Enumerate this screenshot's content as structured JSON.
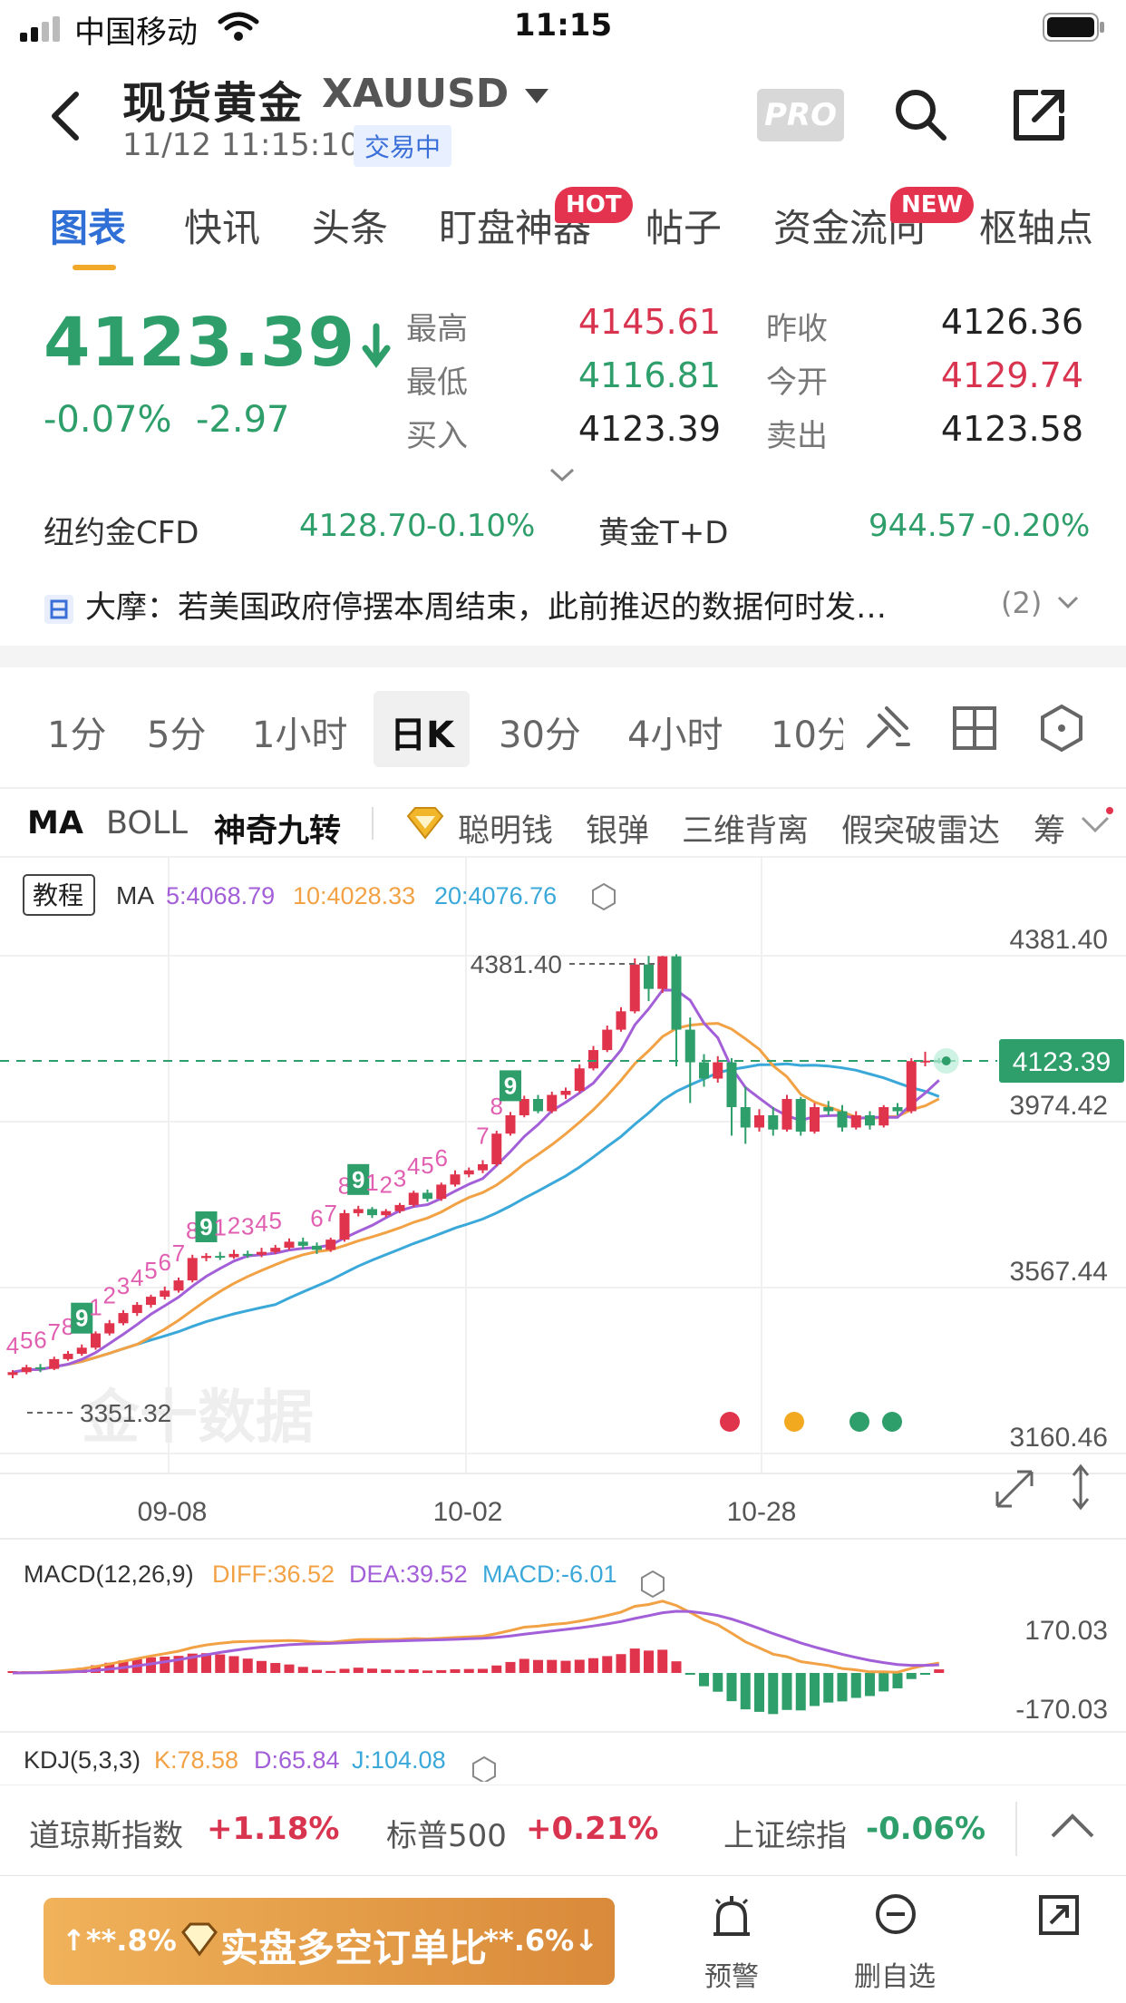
{
  "status_bar": {
    "carrier": "中国移动",
    "time": "11:15"
  },
  "header": {
    "title": "现货黄金",
    "symbol": "XAUUSD",
    "datetime": "11/12 11:15:10",
    "trading_status": "交易中",
    "pro_label": "PRO"
  },
  "tabs": [
    {
      "label": "图表",
      "active": true
    },
    {
      "label": "快讯"
    },
    {
      "label": "头条"
    },
    {
      "label": "盯盘神器",
      "badge": "HOT"
    },
    {
      "label": "帖子"
    },
    {
      "label": "资金流向",
      "badge": "NEW"
    },
    {
      "label": "枢轴点"
    }
  ],
  "quote": {
    "price": "4123.39",
    "change_pct": "-0.07%",
    "change": "-2.97",
    "high_label": "最高",
    "high": "4145.61",
    "low_label": "最低",
    "low": "4116.81",
    "bid_label": "买入",
    "bid": "4123.39",
    "prev_close_label": "昨收",
    "prev_close": "4126.36",
    "open_label": "今开",
    "open": "4129.74",
    "ask_label": "卖出",
    "ask": "4123.58"
  },
  "related": [
    {
      "name": "纽约金CFD",
      "price": "4128.70",
      "chg": "-0.10%"
    },
    {
      "name": "黄金T+D",
      "price": "944.57",
      "chg": "-0.20%"
    }
  ],
  "news": {
    "text": "大摩：若美国政府停摆本周结束，此前推迟的数据何时发…",
    "count": "(2)"
  },
  "periods": [
    {
      "label": "1分"
    },
    {
      "label": "5分"
    },
    {
      "label": "1小时"
    },
    {
      "label": "日K",
      "active": true
    },
    {
      "label": "30分"
    },
    {
      "label": "4小时"
    },
    {
      "label": "10分"
    }
  ],
  "indicators": [
    {
      "label": "MA",
      "bold": true
    },
    {
      "label": "BOLL"
    },
    {
      "label": "神奇九转",
      "bold": true
    },
    {
      "label": "聪明钱"
    },
    {
      "label": "银弹"
    },
    {
      "label": "三维背离"
    },
    {
      "label": "假突破雷达"
    },
    {
      "label": "筹"
    }
  ],
  "chart_data": {
    "type": "candlestick",
    "tutorial_label": "教程",
    "ma_legend": {
      "title": "MA",
      "ma5": "5:4068.79",
      "ma10": "10:4028.33",
      "ma20": "20:4076.76"
    },
    "y_ticks": [
      "4381.40",
      "3974.42",
      "3567.44",
      "3160.46"
    ],
    "ylim": [
      3160.46,
      4381.4
    ],
    "x_ticks": [
      "09-08",
      "10-02",
      "10-28"
    ],
    "current_price": "4123.39",
    "high_marker": "4381.40",
    "low_marker": "3351.32",
    "watermark": "金十数据",
    "candles": [
      [
        3353,
        3360,
        3345,
        3365
      ],
      [
        3360,
        3372,
        3355,
        3378
      ],
      [
        3372,
        3368,
        3360,
        3380
      ],
      [
        3368,
        3392,
        3365,
        3398
      ],
      [
        3392,
        3405,
        3388,
        3412
      ],
      [
        3405,
        3420,
        3400,
        3428
      ],
      [
        3420,
        3455,
        3415,
        3460
      ],
      [
        3455,
        3480,
        3450,
        3488
      ],
      [
        3480,
        3505,
        3475,
        3512
      ],
      [
        3505,
        3525,
        3498,
        3532
      ],
      [
        3525,
        3545,
        3518,
        3550
      ],
      [
        3545,
        3560,
        3538,
        3570
      ],
      [
        3560,
        3585,
        3555,
        3592
      ],
      [
        3585,
        3640,
        3580,
        3648
      ],
      [
        3640,
        3645,
        3632,
        3652
      ],
      [
        3645,
        3642,
        3635,
        3655
      ],
      [
        3642,
        3650,
        3638,
        3660
      ],
      [
        3650,
        3648,
        3640,
        3658
      ],
      [
        3648,
        3655,
        3642,
        3665
      ],
      [
        3655,
        3665,
        3650,
        3672
      ],
      [
        3665,
        3680,
        3660,
        3688
      ],
      [
        3680,
        3670,
        3662,
        3690
      ],
      [
        3670,
        3660,
        3650,
        3678
      ],
      [
        3660,
        3685,
        3655,
        3690
      ],
      [
        3685,
        3750,
        3680,
        3758
      ],
      [
        3750,
        3760,
        3742,
        3768
      ],
      [
        3760,
        3745,
        3738,
        3765
      ],
      [
        3745,
        3755,
        3740,
        3760
      ],
      [
        3755,
        3770,
        3750,
        3775
      ],
      [
        3770,
        3800,
        3765,
        3805
      ],
      [
        3800,
        3785,
        3778,
        3808
      ],
      [
        3785,
        3820,
        3780,
        3825
      ],
      [
        3820,
        3845,
        3815,
        3855
      ],
      [
        3845,
        3855,
        3838,
        3862
      ],
      [
        3855,
        3870,
        3848,
        3880
      ],
      [
        3870,
        3945,
        3865,
        3952
      ],
      [
        3945,
        3990,
        3940,
        3998
      ],
      [
        3990,
        4030,
        3985,
        4038
      ],
      [
        4030,
        4000,
        3995,
        4040
      ],
      [
        4000,
        4040,
        3995,
        4048
      ],
      [
        4040,
        4050,
        4030,
        4058
      ],
      [
        4050,
        4105,
        4045,
        4115
      ],
      [
        4105,
        4150,
        4100,
        4160
      ],
      [
        4150,
        4200,
        4145,
        4210
      ],
      [
        4200,
        4245,
        4195,
        4255
      ],
      [
        4245,
        4360,
        4240,
        4375
      ],
      [
        4360,
        4300,
        4270,
        4381
      ],
      [
        4300,
        4380,
        4290,
        4381
      ],
      [
        4380,
        4200,
        4110,
        4385
      ],
      [
        4200,
        4120,
        4020,
        4230
      ],
      [
        4120,
        4080,
        4060,
        4140
      ],
      [
        4080,
        4120,
        4070,
        4135
      ],
      [
        4120,
        4010,
        3940,
        4130
      ],
      [
        4010,
        3960,
        3920,
        4060
      ],
      [
        3960,
        3990,
        3950,
        4005
      ],
      [
        3990,
        3955,
        3940,
        4010
      ],
      [
        3955,
        4030,
        3950,
        4040
      ],
      [
        4030,
        3950,
        3940,
        4035
      ],
      [
        3950,
        4010,
        3945,
        4020
      ],
      [
        4010,
        4000,
        3990,
        4025
      ],
      [
        4000,
        3960,
        3950,
        4015
      ],
      [
        3960,
        3990,
        3955,
        4000
      ],
      [
        3990,
        3965,
        3955,
        4000
      ],
      [
        3965,
        4010,
        3960,
        4015
      ],
      [
        4010,
        4000,
        3990,
        4020
      ],
      [
        4000,
        4123,
        3995,
        4130
      ],
      [
        4123,
        4124,
        4110,
        4146
      ],
      [
        4124,
        4123,
        4117,
        4130
      ]
    ],
    "td_labels": [
      {
        "i": 0,
        "t": "4"
      },
      {
        "i": 1,
        "t": "5"
      },
      {
        "i": 2,
        "t": "6"
      },
      {
        "i": 3,
        "t": "7"
      },
      {
        "i": 4,
        "t": "8"
      },
      {
        "i": 5,
        "t": "9",
        "box": true
      },
      {
        "i": 6,
        "t": "1"
      },
      {
        "i": 7,
        "t": "2"
      },
      {
        "i": 8,
        "t": "3"
      },
      {
        "i": 9,
        "t": "4"
      },
      {
        "i": 10,
        "t": "5"
      },
      {
        "i": 11,
        "t": "6"
      },
      {
        "i": 12,
        "t": "7"
      },
      {
        "i": 13,
        "t": "8"
      },
      {
        "i": 14,
        "t": "9",
        "box": true
      },
      {
        "i": 15,
        "t": "1"
      },
      {
        "i": 16,
        "t": "2"
      },
      {
        "i": 17,
        "t": "3"
      },
      {
        "i": 18,
        "t": "4"
      },
      {
        "i": 19,
        "t": "5"
      },
      {
        "i": 22,
        "t": "6"
      },
      {
        "i": 23,
        "t": "7"
      },
      {
        "i": 24,
        "t": "8"
      },
      {
        "i": 25,
        "t": "9",
        "box": true
      },
      {
        "i": 26,
        "t": "1"
      },
      {
        "i": 27,
        "t": "2"
      },
      {
        "i": 28,
        "t": "3"
      },
      {
        "i": 29,
        "t": "4"
      },
      {
        "i": 30,
        "t": "5"
      },
      {
        "i": 31,
        "t": "6"
      },
      {
        "i": 34,
        "t": "7"
      },
      {
        "i": 35,
        "t": "8"
      },
      {
        "i": 36,
        "t": "9",
        "box": true
      }
    ],
    "signal_dots": [
      "#e0334c",
      "#f2a920",
      "#2e9e6a",
      "#2e9e6a"
    ],
    "macd": {
      "title": "MACD(12,26,9)",
      "diff": "DIFF:36.52",
      "dea": "DEA:39.52",
      "macd": "MACD:-6.01",
      "y_ticks": [
        "170.03",
        "-170.03"
      ]
    },
    "kdj": {
      "title": "KDJ(5,3,3)",
      "k": "K:78.58",
      "d": "D:65.84",
      "j": "J:104.08"
    },
    "colors": {
      "up": "#e0334c",
      "down": "#2e9e6a",
      "ma5": "#a25fd8",
      "ma10": "#f2a245",
      "ma20": "#3aa8d8"
    }
  },
  "bottom_ticker": [
    {
      "name": "道琼斯指数",
      "chg": "+1.18%",
      "dir": "up"
    },
    {
      "name": "标普500",
      "chg": "+0.21%",
      "dir": "up"
    },
    {
      "name": "上证综指",
      "chg": "-0.06%",
      "dir": "down"
    }
  ],
  "footer": {
    "ratio_left": "↑**.8%",
    "ratio_label": "实盘多空订单比",
    "ratio_right": "**.6%↓",
    "alert_label": "预警",
    "remove_watch_label": "删自选"
  }
}
